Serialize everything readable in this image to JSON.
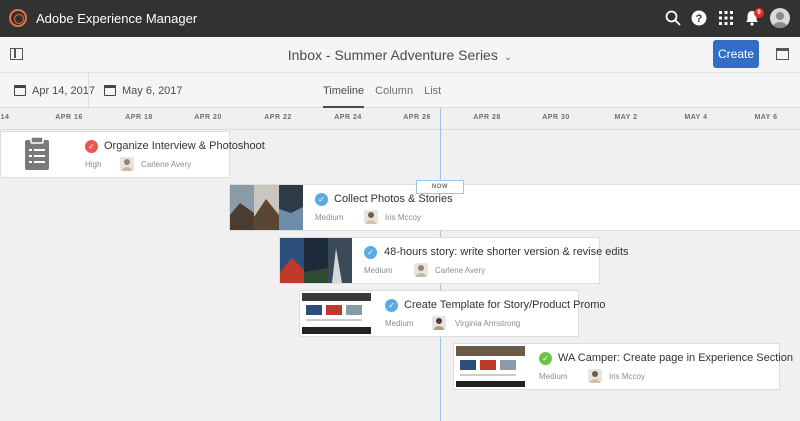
{
  "app": {
    "title": "Adobe Experience Manager",
    "notifications": "9"
  },
  "header": {
    "title": "Inbox - Summer Adventure Series",
    "create_label": "Create"
  },
  "toolbar": {
    "start_date": "Apr 14, 2017",
    "end_date": "May 6, 2017",
    "tabs": [
      "Timeline",
      "Column",
      "List"
    ],
    "active_tab": "Timeline"
  },
  "timeline": {
    "ticks": [
      "14",
      "APR 16",
      "APR 18",
      "APR 20",
      "APR 22",
      "APR 24",
      "APR 26",
      "APR 28",
      "APR 30",
      "MAY 2",
      "MAY 4",
      "MAY 6"
    ],
    "now_label": "NOW"
  },
  "tasks": [
    {
      "title": "Organize Interview & Photoshoot",
      "priority": "High",
      "assignee": "Carlene Avery",
      "status_color": "#e8584f"
    },
    {
      "title": "Collect Photos & Stories",
      "priority": "Medium",
      "assignee": "Iris Mccoy",
      "status_color": "#5aaae6"
    },
    {
      "title": "48-hours story: write shorter version & revise edits",
      "priority": "Medium",
      "assignee": "Carlene Avery",
      "status_color": "#5aaae6"
    },
    {
      "title": "Create Template for Story/Product Promo",
      "priority": "Medium",
      "assignee": "Virginia Armstrong",
      "status_color": "#5aaae6"
    },
    {
      "title": "WA Camper: Create page in Experience Section",
      "priority": "Medium",
      "assignee": "Iris Mccoy",
      "status_color": "#6cc34a"
    }
  ],
  "colors": {
    "accent": "#326ec8",
    "topbar": "#323232",
    "now_line": "#9ec4e8"
  }
}
